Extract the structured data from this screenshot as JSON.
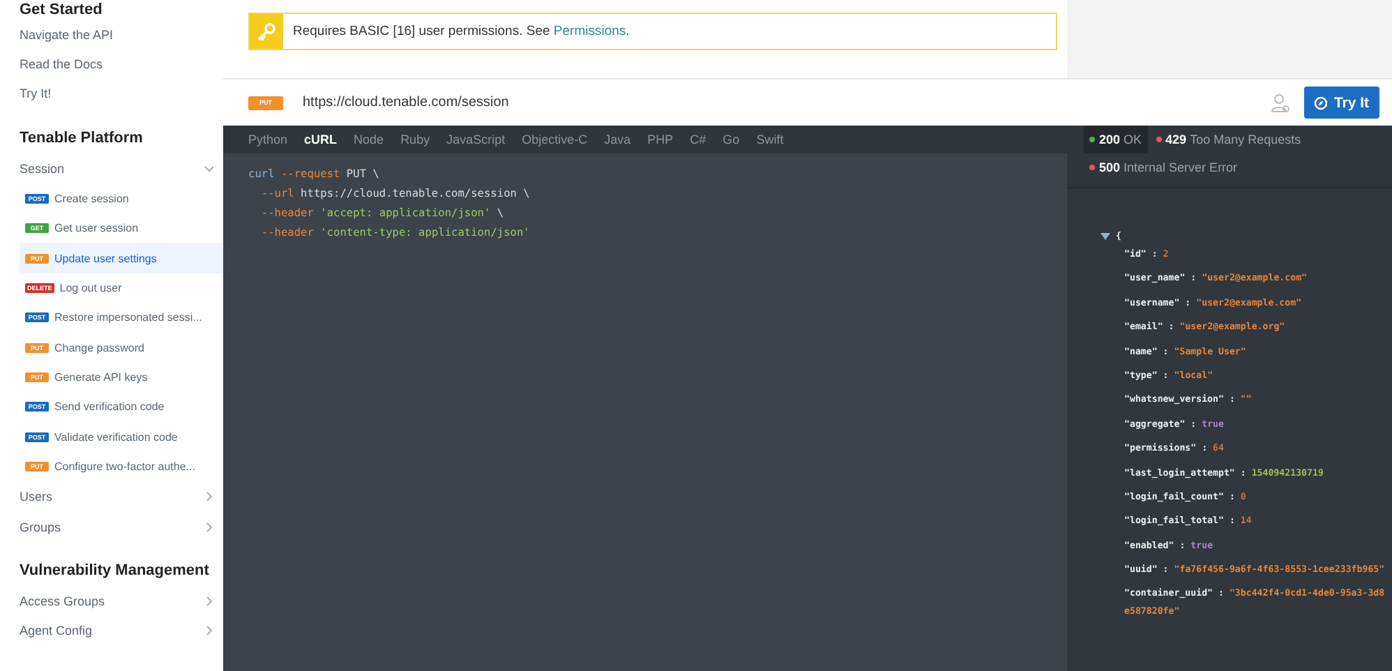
{
  "sidebar": {
    "sections": [
      {
        "title": "Get Started",
        "items": [
          {
            "label": "Navigate the API"
          },
          {
            "label": "Read the Docs"
          },
          {
            "label": "Try It!"
          }
        ]
      },
      {
        "title": "Tenable Platform",
        "items": [
          {
            "label": "Session",
            "expanded": true,
            "children": [
              {
                "method": "POST",
                "label": "Create session",
                "selected": false
              },
              {
                "method": "GET",
                "label": "Get user session",
                "selected": false
              },
              {
                "method": "PUT",
                "label": "Update user settings",
                "selected": true
              },
              {
                "method": "DELETE",
                "label": "Log out user",
                "selected": false
              },
              {
                "method": "POST",
                "label": "Restore impersonated sessi...",
                "selected": false
              },
              {
                "method": "PUT",
                "label": "Change password",
                "selected": false
              },
              {
                "method": "PUT",
                "label": "Generate API keys",
                "selected": false
              },
              {
                "method": "POST",
                "label": "Send verification code",
                "selected": false
              },
              {
                "method": "POST",
                "label": "Validate verification code",
                "selected": false
              },
              {
                "method": "PUT",
                "label": "Configure two-factor authe...",
                "selected": false
              }
            ]
          },
          {
            "label": "Users",
            "expanded": false
          },
          {
            "label": "Groups",
            "expanded": false
          }
        ]
      },
      {
        "title": "Vulnerability Management",
        "items": [
          {
            "label": "Access Groups",
            "expanded": false
          },
          {
            "label": "Agent Config",
            "expanded": false
          }
        ]
      }
    ]
  },
  "notice": {
    "text": "Requires BASIC [16] user permissions. See ",
    "link": "Permissions",
    "end": "."
  },
  "endpoint": {
    "method": "PUT",
    "url": "https://cloud.tenable.com/session",
    "button": "Try It"
  },
  "languages": [
    {
      "label": "Python",
      "selected": false
    },
    {
      "label": "cURL",
      "selected": true
    },
    {
      "label": "Node",
      "selected": false
    },
    {
      "label": "Ruby",
      "selected": false
    },
    {
      "label": "JavaScript",
      "selected": false
    },
    {
      "label": "Objective-C",
      "selected": false
    },
    {
      "label": "Java",
      "selected": false
    },
    {
      "label": "PHP",
      "selected": false
    },
    {
      "label": "C#",
      "selected": false
    },
    {
      "label": "Go",
      "selected": false
    },
    {
      "label": "Swift",
      "selected": false
    }
  ],
  "code": [
    [
      {
        "text": "curl",
        "kind": "command"
      },
      {
        "text": " --request",
        "kind": "flag"
      },
      {
        "text": " PUT \\",
        "kind": "plain"
      }
    ],
    [
      {
        "text": "  --url",
        "kind": "flag"
      },
      {
        "text": " https://cloud.tenable.com/session \\",
        "kind": "plain"
      }
    ],
    [
      {
        "text": "  --header",
        "kind": "flag"
      },
      {
        "text": " 'accept: application/json'",
        "kind": "string"
      },
      {
        "text": " \\",
        "kind": "plain"
      }
    ],
    [
      {
        "text": "  --header",
        "kind": "flag"
      },
      {
        "text": " 'content-type: application/json'",
        "kind": "string"
      }
    ]
  ],
  "responses": [
    {
      "code": "200",
      "label": "OK",
      "color": "#4caf50",
      "selected": true
    },
    {
      "code": "429",
      "label": "Too Many Requests",
      "color": "#e05a5a",
      "selected": false
    },
    {
      "code": "500",
      "label": "Internal Server Error",
      "color": "#e05a5a",
      "selected": false
    }
  ],
  "response_body": {
    "expanded": true,
    "open": "{",
    "separator": ":",
    "fields": [
      {
        "key": "\"id\"",
        "value": "2",
        "kind": "number"
      },
      {
        "key": "\"user_name\"",
        "value": "\"user2@example.com\"",
        "kind": "string"
      },
      {
        "key": "\"username\"",
        "value": "\"user2@example.com\"",
        "kind": "string"
      },
      {
        "key": "\"email\"",
        "value": "\"user2@example.org\"",
        "kind": "string"
      },
      {
        "key": "\"name\"",
        "value": "\"Sample User\"",
        "kind": "string"
      },
      {
        "key": "\"type\"",
        "value": "\"local\"",
        "kind": "string"
      },
      {
        "key": "\"whatsnew_version\"",
        "value": "\"\"",
        "kind": "string"
      },
      {
        "key": "\"aggregate\"",
        "value": "true",
        "kind": "boolean"
      },
      {
        "key": "\"permissions\"",
        "value": "64",
        "kind": "number"
      },
      {
        "key": "\"last_login_attempt\"",
        "value": "1540942130719",
        "kind": "long"
      },
      {
        "key": "\"login_fail_count\"",
        "value": "0",
        "kind": "number"
      },
      {
        "key": "\"login_fail_total\"",
        "value": "14",
        "kind": "number"
      },
      {
        "key": "\"enabled\"",
        "value": "true",
        "kind": "boolean"
      },
      {
        "key": "\"uuid\"",
        "value": "\"fa76f456-9a6f-4f63-8553-1cee233fb965\"",
        "kind": "string"
      },
      {
        "key": "\"container_uuid\"",
        "value": "\"3bc442f4-0cd1-4de0-95a3-3d8e587820fe\"",
        "kind": "string"
      }
    ]
  }
}
